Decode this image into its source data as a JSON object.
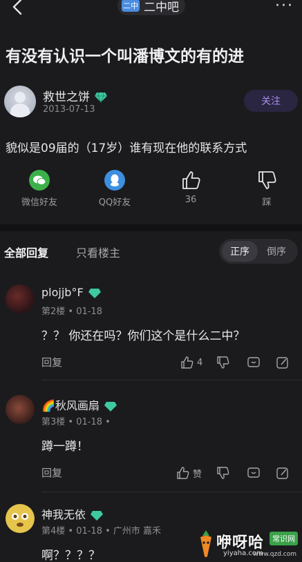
{
  "topbar": {
    "forum_name": "二中吧",
    "forum_logo_text": "二中",
    "more": "···"
  },
  "post": {
    "title": "有没有认识一个叫潘博文的有的进",
    "author": {
      "name": "救世之饼",
      "date": "2013-07-13",
      "follow_label": "关注"
    },
    "content": "貌似是09届的（17岁）谁有现在他的联系方式"
  },
  "actions": {
    "wechat": "微信好友",
    "qq": "QQ好友",
    "like_count": "36",
    "dislike": "踩"
  },
  "tabs": {
    "all": "全部回复",
    "op_only": "只看楼主",
    "sort_asc": "正序",
    "sort_desc": "倒序"
  },
  "replies": [
    {
      "name": "plojjb°F",
      "meta": "第2楼 • 01-18",
      "text": "？？ 你还在吗？你们这个是什么二中？",
      "reply_label": "回复",
      "likes": "4"
    },
    {
      "name": "🌈秋风画扇",
      "meta": "第3楼 • 01-18 •",
      "text": "蹲一蹲！",
      "reply_label": "回复",
      "likes": "赞"
    },
    {
      "name": "神我无依",
      "meta": "第4楼 • 01-18 • 广州市 嘉禾",
      "text": "啊？？？？"
    }
  ],
  "watermark": {
    "text": "咿呀哈",
    "badge": "常识网",
    "url": "yiyaha.com",
    "url2": "www.qzd.com"
  },
  "colors": {
    "background": "#1b1b1d",
    "accent_purple": "#a98ff0",
    "gem": "#3ec9a0",
    "wechat": "#3cb04a",
    "qq": "#3d8fe0"
  }
}
